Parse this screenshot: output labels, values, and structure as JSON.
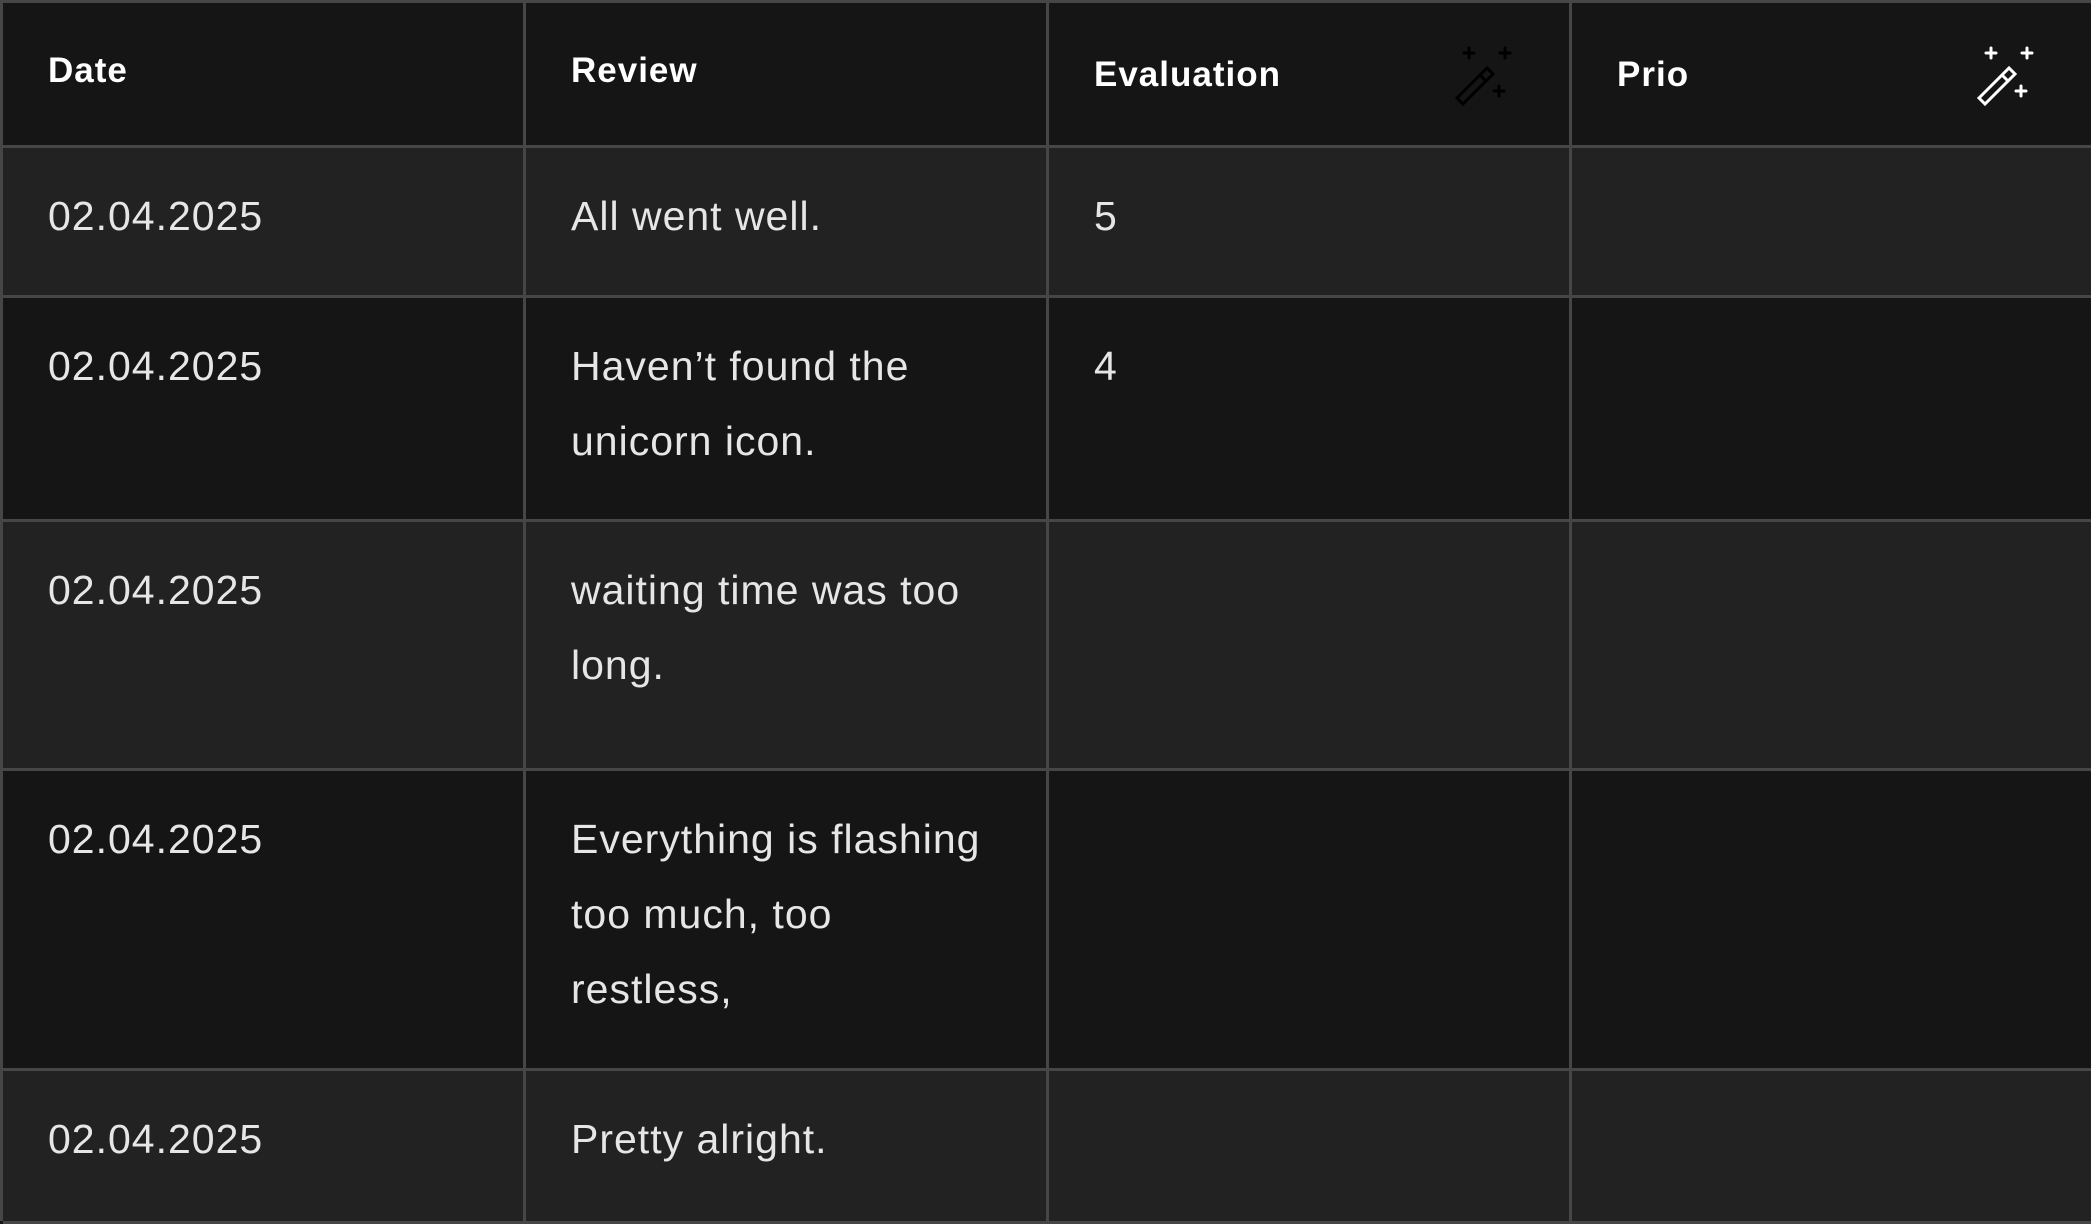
{
  "table": {
    "headers": [
      {
        "label": "Date",
        "icon": null
      },
      {
        "label": "Review",
        "icon": null
      },
      {
        "label": "Evaluation",
        "icon": "magic-wand-sparkles-icon"
      },
      {
        "label": "Prio",
        "icon": "magic-wand-sparkles-icon"
      }
    ],
    "rows": [
      {
        "date": "02.04.2025",
        "review": "All went well.",
        "evaluation": "5",
        "prio": ""
      },
      {
        "date": "02.04.2025",
        "review": "Haven’t found the unicorn icon.",
        "evaluation": "4",
        "prio": ""
      },
      {
        "date": "02.04.2025",
        "review": "waiting time was too long.",
        "evaluation": "",
        "prio": ""
      },
      {
        "date": "02.04.2025",
        "review": "Everything is flashing too much, too restless,",
        "evaluation": "",
        "prio": ""
      },
      {
        "date": "02.04.2025",
        "review": "Pretty alright.",
        "evaluation": "",
        "prio": ""
      }
    ]
  },
  "colors": {
    "background_dark": "#151515",
    "background_light": "#222222",
    "grid_line": "#464646",
    "text": "#e6e6e6",
    "header_text": "#ffffff",
    "icon": "#000000"
  }
}
